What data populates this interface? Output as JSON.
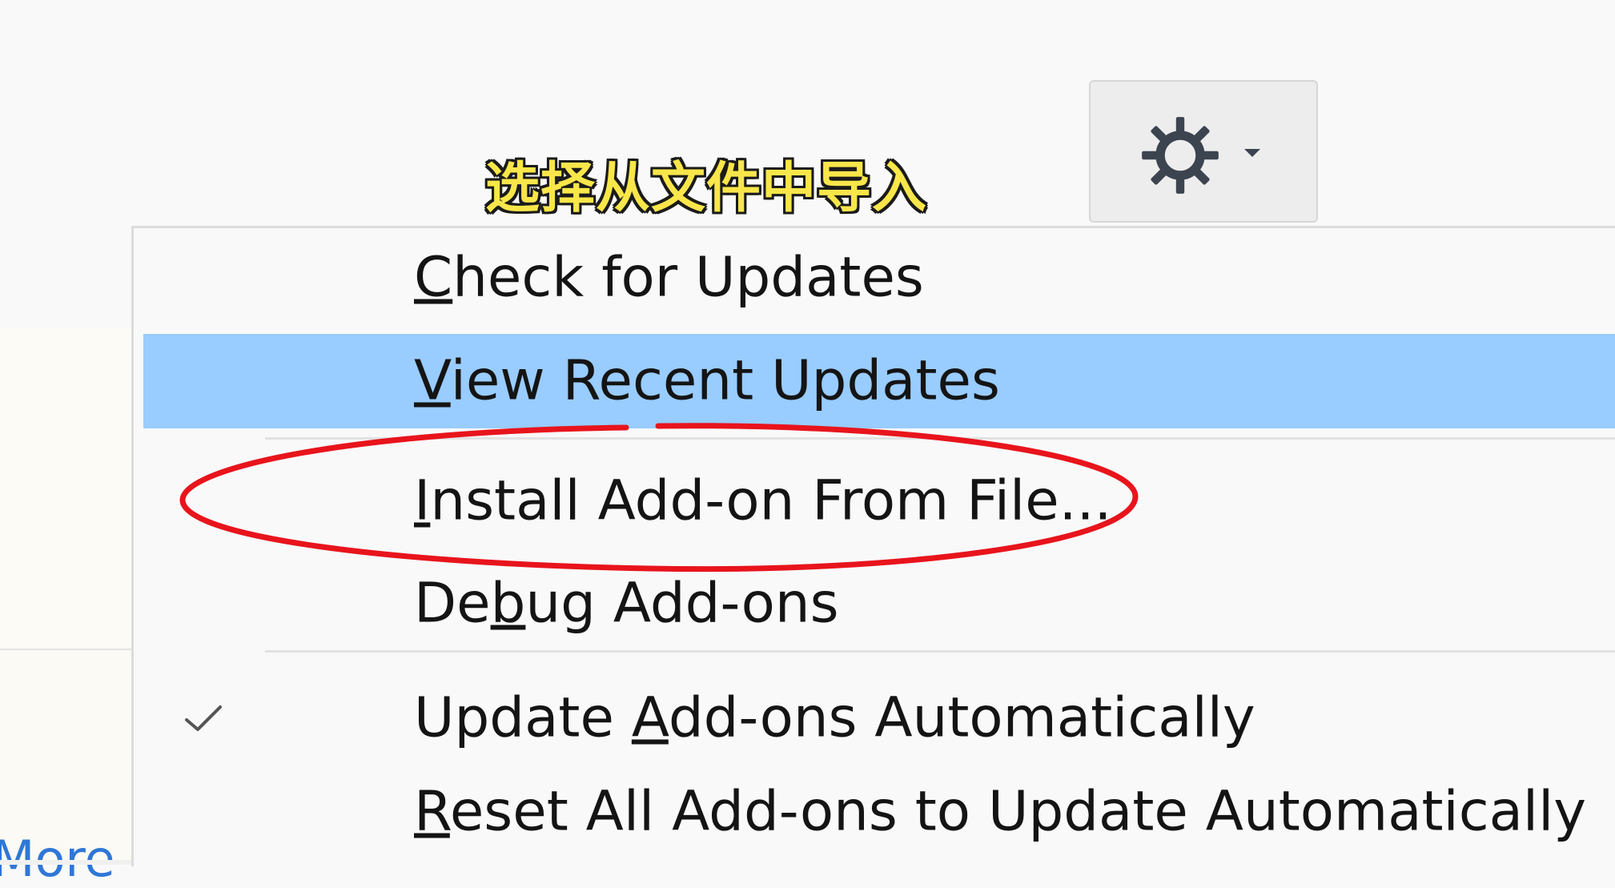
{
  "caption": "选择从文件中导入",
  "background": {
    "link_fragment": "More"
  },
  "toolbar": {
    "gear_icon": "gear-icon",
    "caret_icon": "caret-down-icon"
  },
  "menu": {
    "items": [
      {
        "label": "Check for Updates",
        "mnemonic": "C"
      },
      {
        "label": "View Recent Updates",
        "mnemonic": "V",
        "highlighted": true
      },
      {
        "label": "Install Add-on From File...",
        "mnemonic": "I",
        "annotated": true
      },
      {
        "label": "Debug Add-ons",
        "mnemonic": "b"
      },
      {
        "label": "Update Add-ons Automatically",
        "mnemonic": "A",
        "checked": true
      },
      {
        "label": "Reset All Add-ons to Update Automatically",
        "mnemonic": "R"
      }
    ]
  },
  "colors": {
    "highlight": "#99ccff",
    "annotation": "#e8141c",
    "caption_text": "#f8e64a",
    "link": "#2f77d6"
  }
}
